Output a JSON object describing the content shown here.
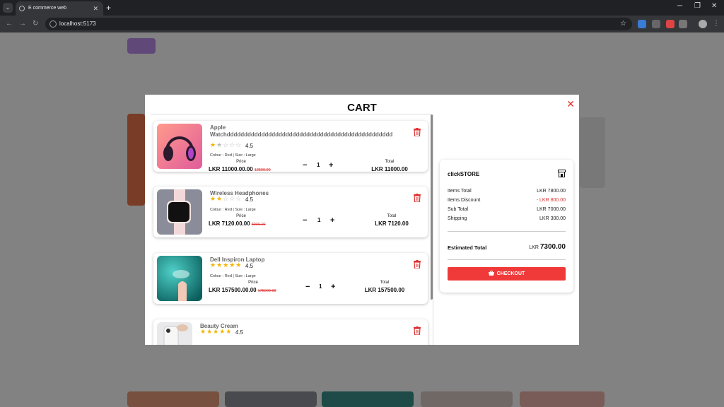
{
  "browser": {
    "tab_title": "E commerce web",
    "url": "localhost:5173"
  },
  "cart": {
    "title": "CART",
    "items": [
      {
        "name": "Apple Watchdddddddddddddddddddddddddddddddddddddddddddddddd",
        "rating": "4.5",
        "stars_filled": 1.5,
        "variant": "Colour : Red | Size : Large",
        "price_label": "Price",
        "price": "LKR 11000.00.00",
        "old_price": "12500.00",
        "quantity": "1",
        "total_label": "Total",
        "total": "LKR 11000.00"
      },
      {
        "name": "Wireless Headphones",
        "rating": "4.5",
        "stars_filled": 2,
        "variant": "Colour : Red | Size : Large",
        "price_label": "Price",
        "price": "LKR 7120.00.00",
        "old_price": "8900.00",
        "quantity": "1",
        "total_label": "Total",
        "total": "LKR 7120.00"
      },
      {
        "name": "Dell Inspiron Laptop",
        "rating": "4.5",
        "stars_filled": 5,
        "variant": "Colour : Red | Size : Large",
        "price_label": "Price",
        "price": "LKR 157500.00.00",
        "old_price": "175000.00",
        "quantity": "1",
        "total_label": "Total",
        "total": "LKR 157500.00"
      },
      {
        "name": "Beauty Cream",
        "rating": "4.5",
        "stars_filled": 5
      }
    ]
  },
  "summary": {
    "store": "clickSTORE",
    "rows": [
      {
        "label": "Items Total",
        "value": "LKR 7800.00"
      },
      {
        "label": "Items Discount",
        "value": "- LKR 800.00"
      },
      {
        "label": "Sub Total",
        "value": "LKR 7000.00"
      },
      {
        "label": "Shipping",
        "value": "LKR 300.00"
      }
    ],
    "estimated_label": "Estimated Total",
    "estimated_currency": "LKR",
    "estimated_value": "7300.00",
    "checkout_label": "CHECKOUT"
  },
  "colors": {
    "accent": "#f03a3a",
    "star": "#f5b400"
  }
}
